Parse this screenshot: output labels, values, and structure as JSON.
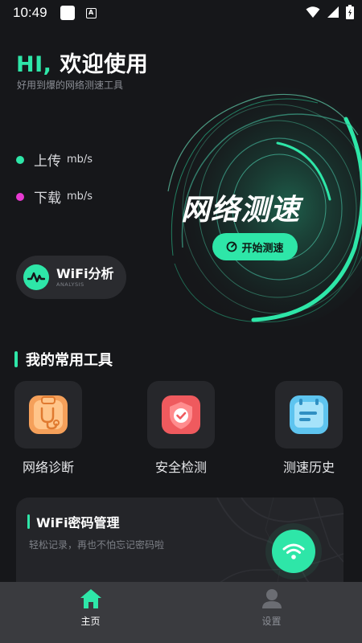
{
  "status_bar": {
    "time": "10:49",
    "notification_icons": [
      "app-icon",
      "a-icon"
    ],
    "right_icons": [
      "wifi-icon",
      "signal-icon",
      "battery-icon"
    ]
  },
  "header": {
    "greeting_hi": "HI,",
    "greeting_text": "欢迎使用",
    "subtitle": "好用到爆的网络测速工具"
  },
  "speed": {
    "upload": {
      "label": "上传",
      "unit": "mb/s",
      "color": "#2ee6a8"
    },
    "download": {
      "label": "下载",
      "unit": "mb/s",
      "color": "#e83ad2"
    }
  },
  "wifi_analysis": {
    "title": "WiFi分析",
    "subtitle": "ANALYSIS"
  },
  "speed_test": {
    "title": "网络测速",
    "button_label": "开始测速"
  },
  "tools_section": {
    "title": "我的常用工具",
    "items": [
      {
        "label": "网络诊断",
        "icon": "stethoscope-icon",
        "color": "#f5a05a"
      },
      {
        "label": "安全检测",
        "icon": "shield-check-icon",
        "color": "#ef5a5e"
      },
      {
        "label": "测速历史",
        "icon": "history-card-icon",
        "color": "#5ec4ef"
      }
    ]
  },
  "password_card": {
    "title": "WiFi密码管理",
    "description": "轻松记录，再也不怕忘记密码啦",
    "icon": "wifi-icon"
  },
  "bottom_nav": {
    "items": [
      {
        "label": "主页",
        "icon": "home-icon",
        "active": true
      },
      {
        "label": "设置",
        "icon": "user-icon",
        "active": false
      }
    ]
  },
  "colors": {
    "accent": "#2ee6a8",
    "background": "#16171a",
    "card": "#242529"
  }
}
